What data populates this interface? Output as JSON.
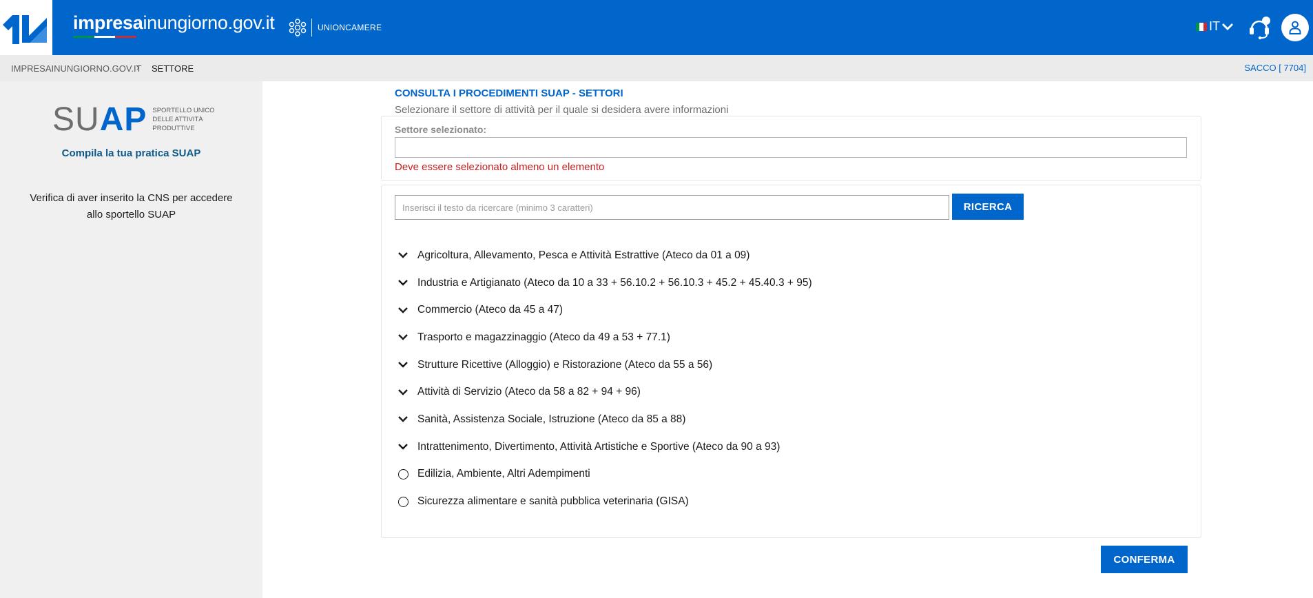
{
  "header": {
    "brand_bold": "impresa",
    "brand_mid": "inungiorno",
    "brand_suffix": ".gov.it",
    "partner_label": "UNIONCAMERE",
    "language": "IT",
    "colors": {
      "primary": "#0066cc",
      "flag_green": "#009246",
      "flag_white": "#ffffff",
      "flag_red": "#ce2b37"
    },
    "icons": {
      "logo": "logo-icon",
      "partner": "unioncamere-icon",
      "lang_toggle": "chevron-down-icon",
      "help": "help-headset-icon",
      "user": "user-icon"
    }
  },
  "breadcrumb": {
    "home": "IMPRESAINUNGIORNO.GOV.IT",
    "separator": "›",
    "current": "SETTORE",
    "user_code": "SACCO [ 7704]"
  },
  "sidebar": {
    "logo_su": "SU",
    "logo_ap": "AP",
    "logo_desc": [
      "SPORTELLO UNICO",
      "DELLE ATTIVITÀ",
      "PRODUTTIVE"
    ],
    "cta": "Compila la tua pratica SUAP",
    "notice": "Verifica di aver inserito la CNS per accedere allo sportello SUAP"
  },
  "main": {
    "title": "CONSULTA I PROCEDIMENTI SUAP - SETTORI",
    "subtitle": "Selezionare il settore di attività per il quale si desidera avere informazioni",
    "selected_label": "Settore selezionato:",
    "selected_value": "",
    "error": "Deve essere selezionato almeno un elemento",
    "search_placeholder": "Inserisci il testo da ricercare (minimo 3 caratteri)",
    "search_button": "RICERCA",
    "confirm_button": "CONFERMA",
    "sectors": [
      {
        "label": "Agricoltura, Allevamento, Pesca e Attività Estrattive (Ateco da 01 a 09)",
        "icon": "chevron-down-icon"
      },
      {
        "label": "Industria e Artigianato (Ateco da 10 a 33 + 56.10.2 + 56.10.3 + 45.2 + 45.40.3 + 95)",
        "icon": "chevron-down-icon"
      },
      {
        "label": "Commercio (Ateco da 45 a 47)",
        "icon": "chevron-down-icon"
      },
      {
        "label": "Trasporto e magazzinaggio (Ateco da 49 a 53 + 77.1)",
        "icon": "chevron-down-icon"
      },
      {
        "label": "Strutture Ricettive (Alloggio) e Ristorazione (Ateco da 55 a 56)",
        "icon": "chevron-down-icon"
      },
      {
        "label": "Attività di Servizio (Ateco da 58 a 82 + 94 + 96)",
        "icon": "chevron-down-icon"
      },
      {
        "label": "Sanità, Assistenza Sociale, Istruzione (Ateco da 85 a 88)",
        "icon": "chevron-down-icon"
      },
      {
        "label": "Intrattenimento, Divertimento, Attività Artistiche e Sportive (Ateco da 90 a 93)",
        "icon": "chevron-down-icon"
      },
      {
        "label": "Edilizia, Ambiente, Altri Adempimenti",
        "icon": "radio-icon"
      },
      {
        "label": "Sicurezza alimentare e sanità pubblica veterinaria (GISA)",
        "icon": "radio-icon"
      }
    ]
  }
}
